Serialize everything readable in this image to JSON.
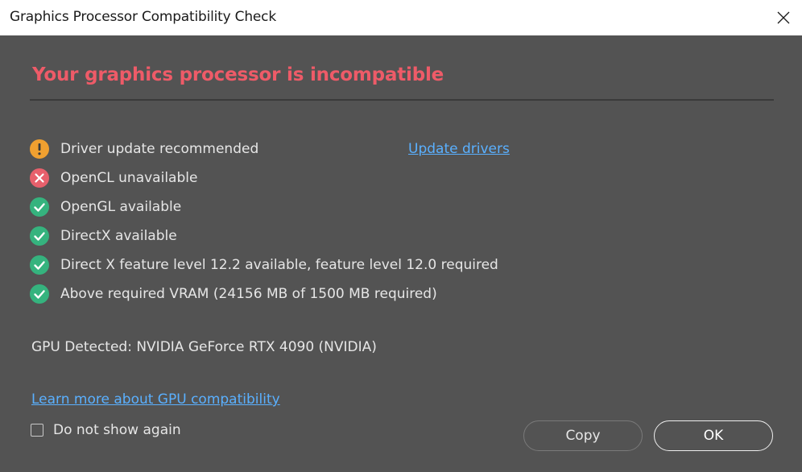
{
  "window": {
    "title": "Graphics Processor Compatibility Check",
    "close_icon": "close-icon"
  },
  "dialog": {
    "heading": "Your graphics processor is incompatible",
    "heading_color": "#ee5b68",
    "checks": [
      {
        "status": "warning",
        "icon": "warning-icon",
        "label": "Driver update recommended"
      },
      {
        "status": "error",
        "icon": "error-icon",
        "label": "OpenCL unavailable"
      },
      {
        "status": "ok",
        "icon": "check-icon",
        "label": "OpenGL available"
      },
      {
        "status": "ok",
        "icon": "check-icon",
        "label": "DirectX available"
      },
      {
        "status": "ok",
        "icon": "check-icon",
        "label": "Direct X feature level 12.2 available, feature level 12.0 required"
      },
      {
        "status": "ok",
        "icon": "check-icon",
        "label": "Above required VRAM (24156 MB of 1500 MB required)"
      }
    ],
    "update_drivers_link": "Update drivers",
    "gpu_detected": "GPU Detected: NVIDIA GeForce RTX 4090 (NVIDIA)",
    "learn_more_link": "Learn more about GPU compatibility",
    "do_not_show_label": "Do not show again",
    "do_not_show_checked": false,
    "copy_button": "Copy",
    "ok_button": "OK"
  },
  "colors": {
    "warning": "#f0a030",
    "error": "#e8606c",
    "ok": "#35b37e",
    "link": "#5ab0ff",
    "background": "#535353"
  }
}
